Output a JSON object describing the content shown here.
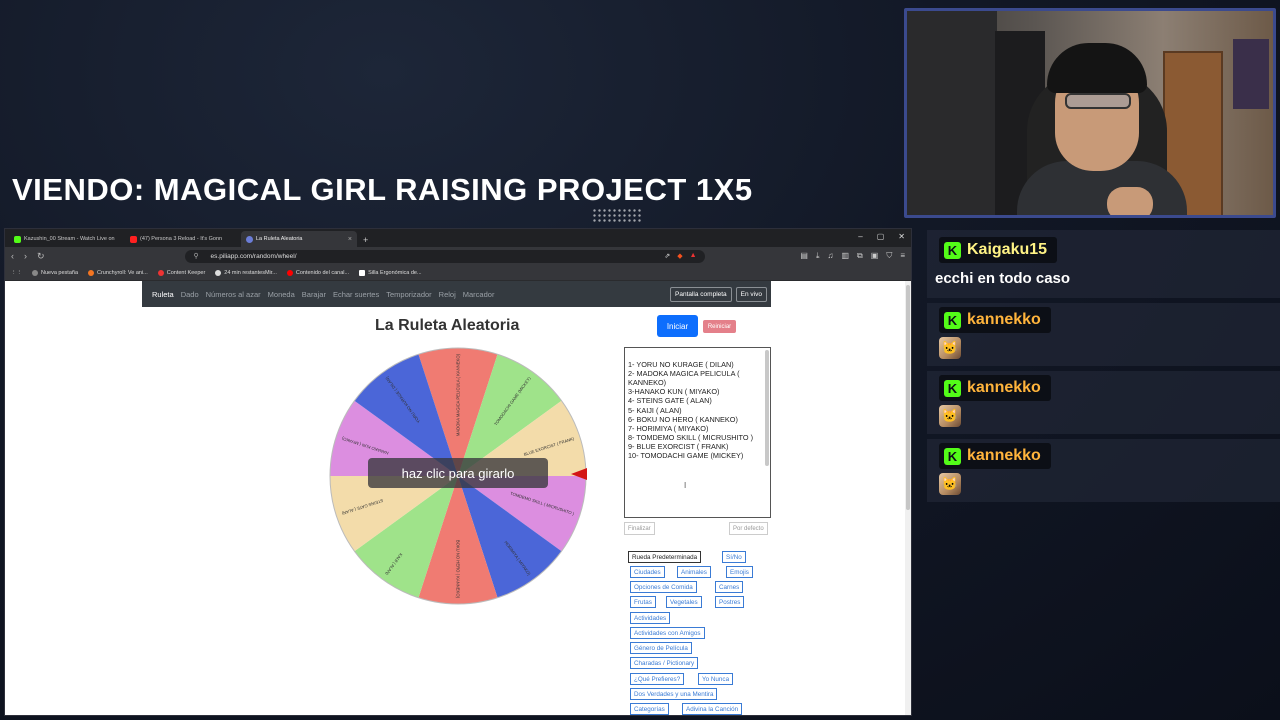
{
  "overlay": {
    "title": "VIENDO: MAGICAL GIRL RAISING PROJECT 1X5"
  },
  "browser": {
    "tabs": [
      {
        "label": "Kazushin_00 Stream - Watch Live on",
        "color": "#53fc18",
        "active": false
      },
      {
        "label": "(47) Persona 3 Reload - It's Gonn",
        "color": "#ff2020",
        "active": false
      },
      {
        "label": "La Ruleta Aleatoria",
        "color": "#6b7dd8",
        "active": true
      }
    ],
    "url": "es.piliapp.com/random/wheel/",
    "bookmarks": [
      {
        "label": "Nueva pestaña",
        "color": "#888"
      },
      {
        "label": "Crunchyroll: Ve ani...",
        "color": "#f47521"
      },
      {
        "label": "Content Keeper",
        "color": "#e33"
      },
      {
        "label": "24 min restantesMir...",
        "color": "#ddd"
      },
      {
        "label": "Contenido del canal...",
        "color": "#f00"
      },
      {
        "label": "Silla Ergonómica de...",
        "color": "#fff"
      }
    ]
  },
  "site": {
    "nav": [
      "Ruleta",
      "Dado",
      "Números al azar",
      "Moneda",
      "Barajar",
      "Echar suertes",
      "Temporizador",
      "Reloj",
      "Marcador"
    ],
    "fullscreen": "Pantalla completa",
    "live": "En vivo",
    "title": "La Ruleta Aleatoria",
    "start": "Iniciar",
    "reset": "Reiniciar",
    "spin_label": "haz clic para girarlo",
    "entries": "1- YORU NO KURAGE ( DILAN)\n2- MADOKA MAGICA PELICULA ( KANNEKO)\n3-HANAKO KUN ( MIYAKO)\n4- STEINS GATE ( ALAN)\n5- KAIJI ( ALAN)\n6- BOKU NO HERO ( KANNEKO)\n7- HORIMIYA ( MIYAKO)\n8- TOMDEMO SKILL ( MICRUSHITO )\n9- BLUE EXORCIST ( FRANK)\n10- TOMODACHI GAME (MICKEY)",
    "finish": "Finalizar",
    "default": "Por defecto",
    "presets": [
      "Rueda Predeterminada",
      "Sí/No",
      "Ciudades",
      "Animales",
      "Emojis",
      "Opciones de Comida",
      "Carnes",
      "Frutas",
      "Vegetales",
      "Postres",
      "Actividades",
      "Actividades con Amigos",
      "Género de Película",
      "Charadas / Pictionary",
      "¿Qué Prefieres?",
      "Yo Nunca",
      "Dos Verdades y una Mentira",
      "Categorías",
      "Adivina la Canción"
    ],
    "wheel_colors": [
      "#f07b72",
      "#9fe38a",
      "#f3dcaa",
      "#dc8ee0",
      "#4b66d8",
      "#f07b72",
      "#9fe38a",
      "#f3dcaa",
      "#dc8ee0",
      "#4b66d8"
    ],
    "wheel_labels": [
      "MADOKA MAGICA PELICULA ( KANNEKO)",
      "TOMODACHI GAME (MICKEY)",
      "BLUE EXORCIST ( FRANK)",
      "TOMDEMO SKILL ( MICRUSHITO )",
      "HORIMIYA ( MIYAKO)",
      "BOKU NO HERO ( KANNEKO)",
      "KAIJI ( ALAN)",
      "STEINS GATE ( ALAN)",
      "HANAKO KUN ( MIYAKO)",
      "YORU NO KURAGE ( DILAN)"
    ]
  },
  "chat": [
    {
      "user": "Kaigaku15",
      "color": "#fff385",
      "text": "ecchi en todo caso",
      "emote": false
    },
    {
      "user": "kannekko",
      "color": "#ffb43c",
      "text": "",
      "emote": true
    },
    {
      "user": "kannekko",
      "color": "#ffb43c",
      "text": "",
      "emote": true
    },
    {
      "user": "kannekko",
      "color": "#ffb43c",
      "text": "",
      "emote": true
    }
  ]
}
